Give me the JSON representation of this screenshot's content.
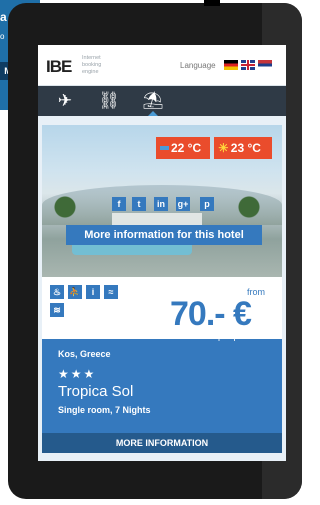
{
  "background_page": {
    "text1": "a",
    "text2": "o",
    "text3": "M"
  },
  "header": {
    "logo_mark": "IBE",
    "logo_lines": [
      "Internet",
      "booking",
      "engine"
    ],
    "language_label": "Language",
    "flags": [
      "flag-de",
      "flag-uk",
      "flag-rs"
    ]
  },
  "nav": {
    "items": [
      {
        "icon": "airplane-icon",
        "glyph": "✈"
      },
      {
        "icon": "lock-icon",
        "glyph": "⛓"
      },
      {
        "icon": "beach-icon",
        "glyph": "⛱"
      }
    ],
    "active_index": 2
  },
  "hotel": {
    "temp_cold": "22 °C",
    "temp_hot": "23 °C",
    "social": [
      "f",
      "t",
      "in",
      "g+",
      "p"
    ],
    "more_info_hotel": "More information for this hotel",
    "amenities": [
      "♨",
      "⛹",
      "i",
      "≈",
      "≋"
    ],
    "from_label": "from",
    "price": "70.- €",
    "per_person": "per person",
    "location": "Kos, Greece",
    "stars": "★★★",
    "name": "Tropica Sol",
    "room": "Single room, 7 Nights",
    "more_info_button": "MORE INFORMATION"
  },
  "colors": {
    "accent": "#3579be",
    "temp_badge": "#ea4c2c",
    "nav_bg": "#2f3a46"
  }
}
